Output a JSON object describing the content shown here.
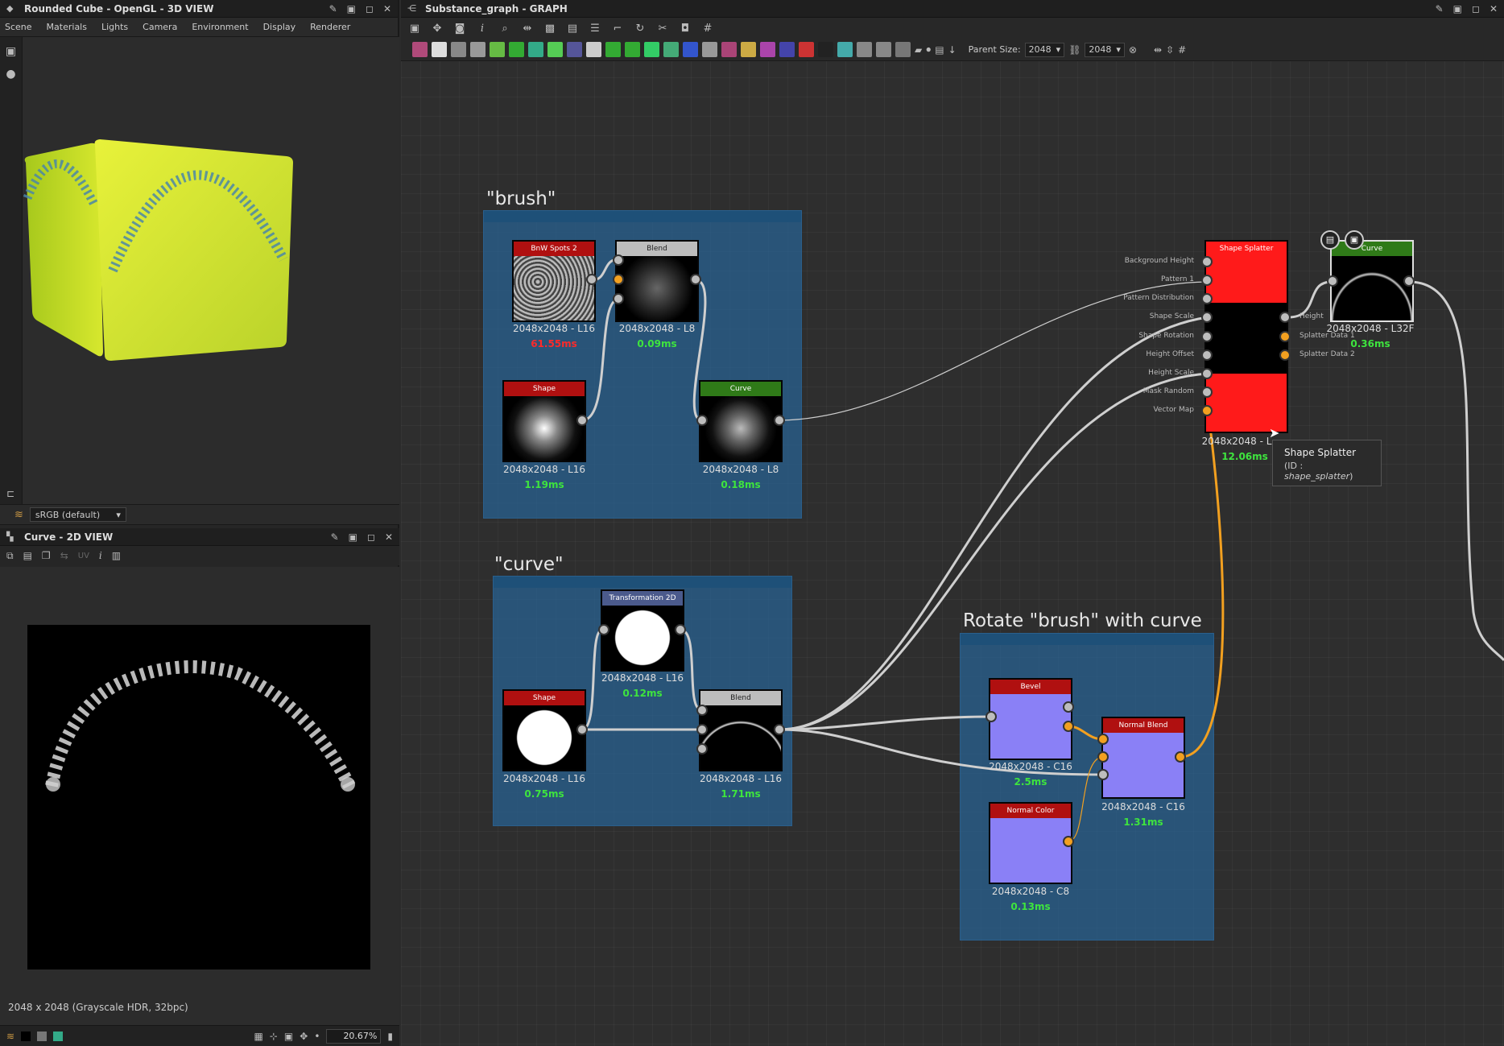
{
  "view3d": {
    "title": "Rounded Cube - OpenGL - 3D VIEW",
    "menu": [
      "Scene",
      "Materials",
      "Lights",
      "Camera",
      "Environment",
      "Display",
      "Renderer"
    ],
    "colorspace": "sRGB (default)"
  },
  "view2d": {
    "title": "Curve - 2D VIEW",
    "uv_label": "UV",
    "info": "2048 x 2048 (Grayscale HDR, 32bpc)",
    "zoom": "20.67%"
  },
  "graph": {
    "title": "Substance_graph - GRAPH",
    "parent_size_label": "Parent Size:",
    "parent_size": "2048",
    "output_size": "2048",
    "frames": [
      {
        "title": "\"brush\""
      },
      {
        "title": "\"curve\""
      },
      {
        "title": "Rotate \"brush\" with curve"
      }
    ],
    "nodes": {
      "bnw_spots": {
        "header": "BnW Spots 2",
        "size": "2048x2048 - L16",
        "time": "61.55ms"
      },
      "blend1": {
        "header": "Blend",
        "size": "2048x2048 - L8",
        "time": "0.09ms"
      },
      "shape1": {
        "header": "Shape",
        "size": "2048x2048 - L16",
        "time": "1.19ms"
      },
      "curve1": {
        "header": "Curve",
        "size": "2048x2048 - L8",
        "time": "0.18ms"
      },
      "transform2d": {
        "header": "Transformation 2D",
        "size": "2048x2048 - L16",
        "time": "0.12ms"
      },
      "shape2": {
        "header": "Shape",
        "size": "2048x2048 - L16",
        "time": "0.75ms"
      },
      "blend2": {
        "header": "Blend",
        "size": "2048x2048 - L16",
        "time": "1.71ms"
      },
      "bevel": {
        "header": "Bevel",
        "size": "2048x2048 - C16",
        "time": "2.5ms"
      },
      "normal_blend": {
        "header": "Normal Blend",
        "size": "2048x2048 - C16",
        "time": "1.31ms"
      },
      "normal_color": {
        "header": "Normal Color",
        "size": "2048x2048 - C8",
        "time": "0.13ms"
      },
      "shape_splatter": {
        "header": "Shape Splatter",
        "size": "2048x2048 - L",
        "time": "12.06ms"
      },
      "curve_out": {
        "header": "Curve",
        "size": "2048x2048 - L32F",
        "time": "0.36ms"
      }
    },
    "splatter_inputs": [
      "Background Height",
      "Pattern 1",
      "Pattern Distribution",
      "Shape Scale",
      "Shape Rotation",
      "Height Offset",
      "Height Scale",
      "Mask Random",
      "Vector Map"
    ],
    "splatter_outputs": [
      "Height",
      "Splatter Data 1",
      "Splatter Data 2"
    ],
    "tooltip": {
      "title": "Shape Splatter",
      "id_label": "(ID : ",
      "id": "shape_splatter",
      "id_close": ")"
    }
  }
}
